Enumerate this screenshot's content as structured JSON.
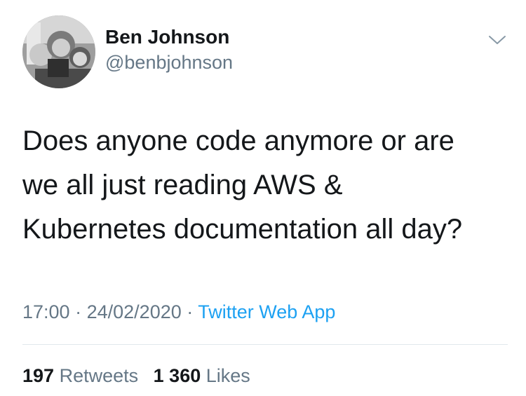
{
  "user": {
    "display_name": "Ben Johnson",
    "handle": "@benbjohnson",
    "avatar_icon": "avatar-photo"
  },
  "tweet": {
    "lines": [
      "Does anyone code anymore or are",
      "we all just reading AWS &",
      "Kubernetes documentation all day?"
    ],
    "time": "17:00",
    "separator": "·",
    "date": "24/02/2020",
    "source": "Twitter Web App"
  },
  "stats": {
    "retweets_count": "197",
    "retweets_label": "Retweets",
    "likes_count": "1 360",
    "likes_label": "Likes"
  },
  "icons": {
    "menu": "chevron-down-icon"
  },
  "colors": {
    "text": "#14171a",
    "secondary": "#657786",
    "link": "#1da1f2",
    "divider": "#e1e8ed"
  }
}
